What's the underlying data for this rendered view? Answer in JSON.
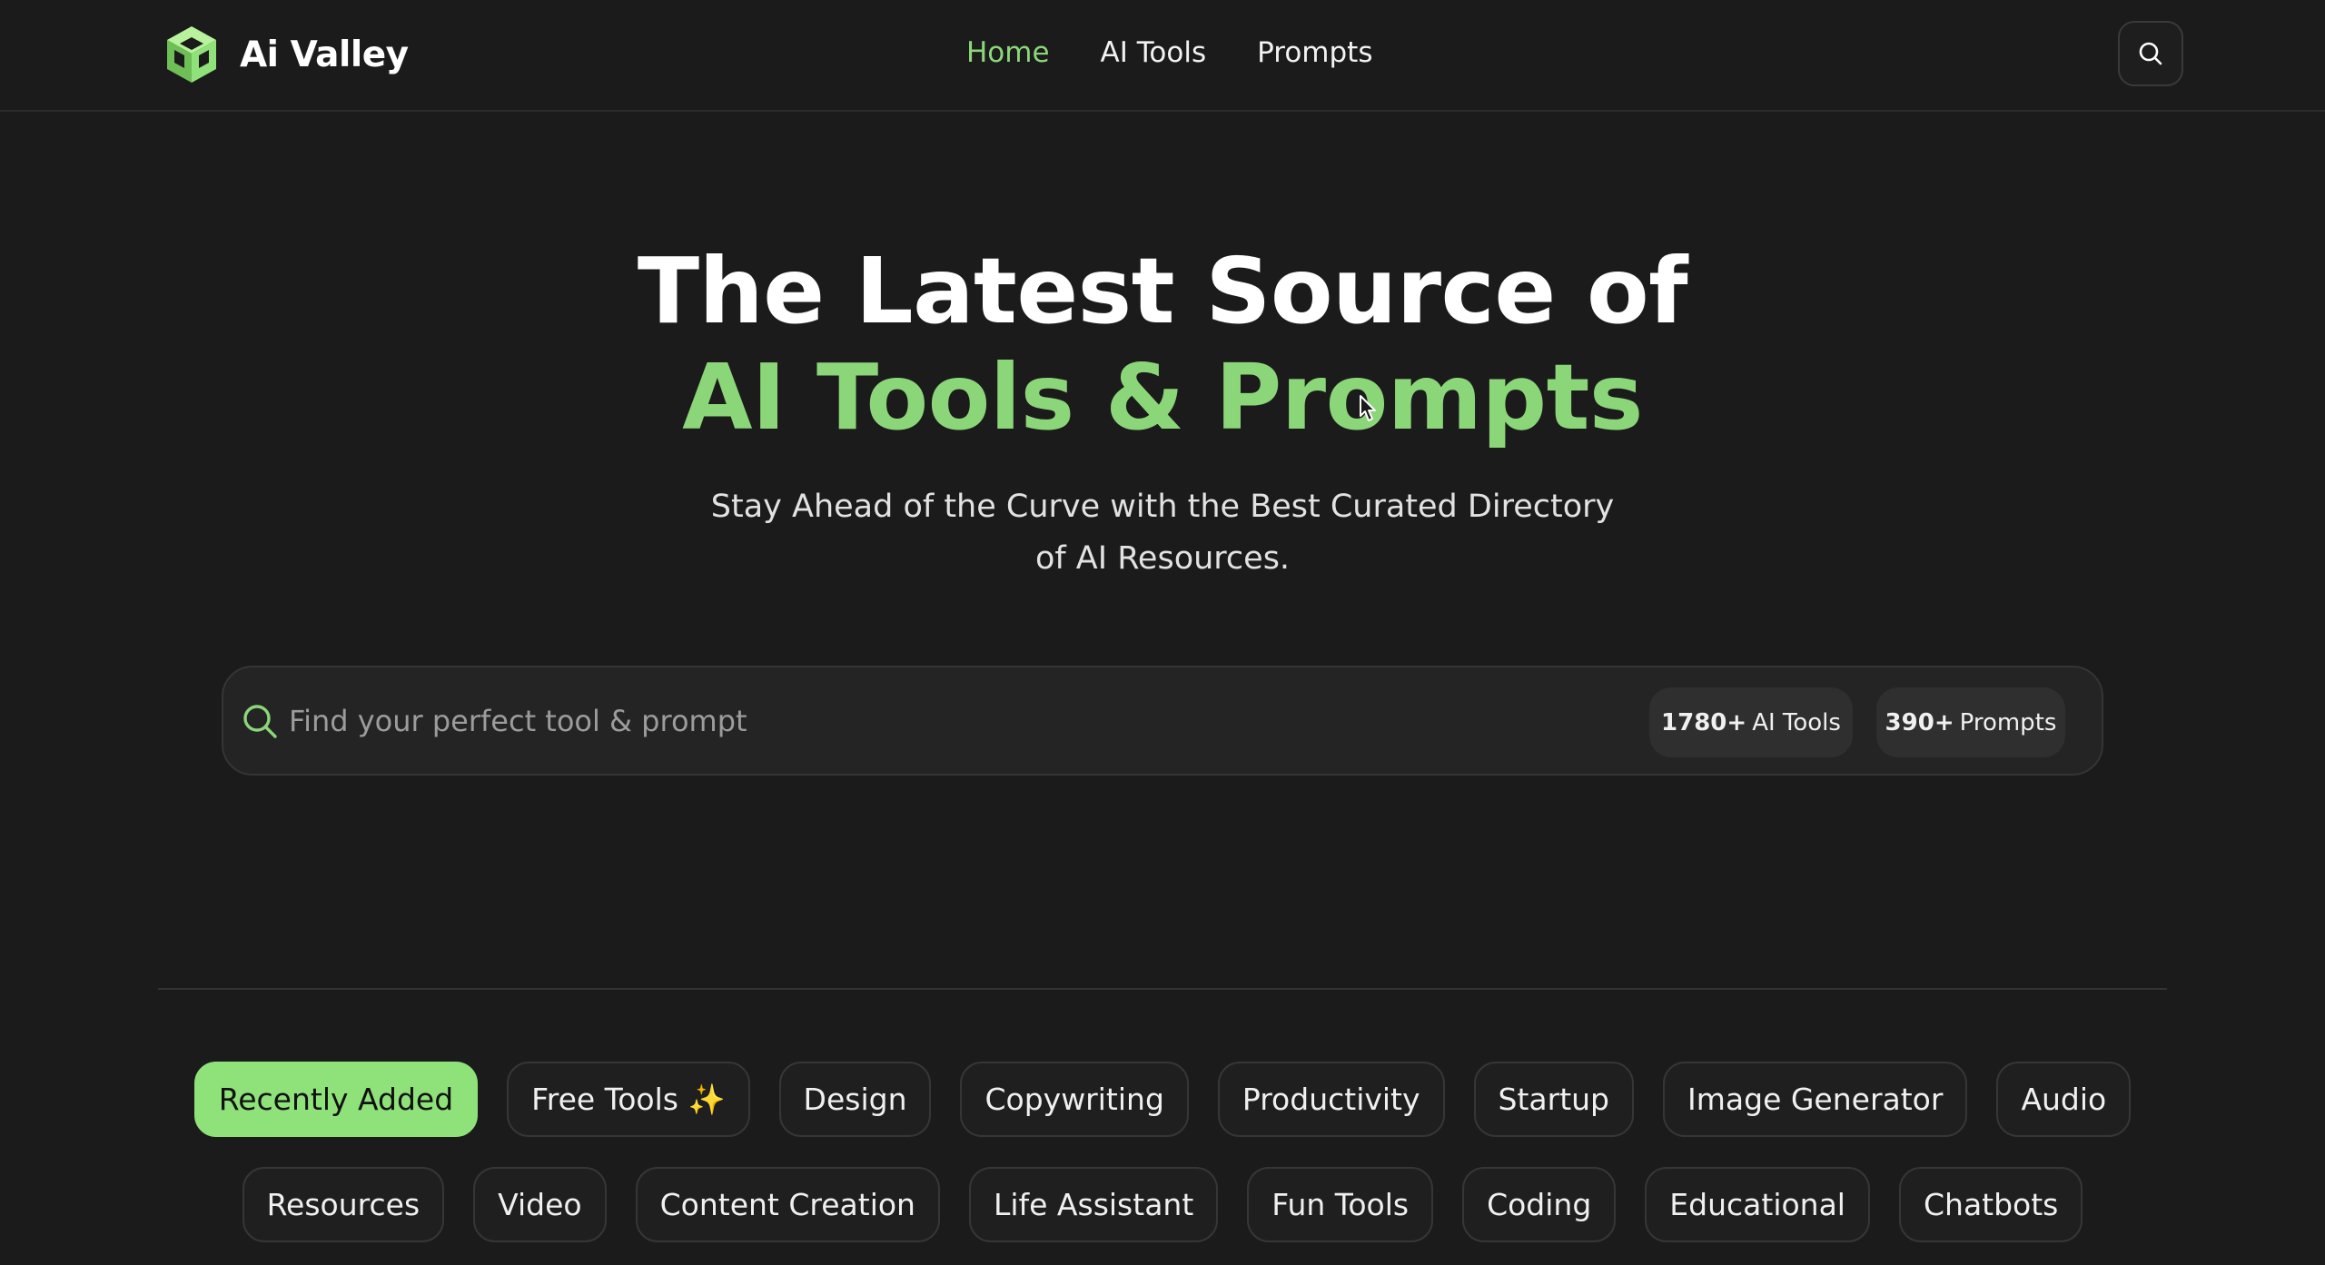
{
  "header": {
    "brand": "Ai Valley",
    "nav": [
      {
        "label": "Home",
        "active": true
      },
      {
        "label": "AI Tools",
        "active": false
      },
      {
        "label": "Prompts",
        "active": false
      }
    ],
    "search_icon": "search-icon"
  },
  "hero": {
    "line1": "The Latest Source of",
    "line2": "AI Tools & Prompts",
    "subtitle_line1": "Stay Ahead of the Curve with the Best Curated Directory",
    "subtitle_line2": "of AI Resources."
  },
  "search": {
    "placeholder": "Find your perfect tool & prompt",
    "value": "",
    "tools_count": "1780+",
    "tools_label": "AI Tools",
    "prompts_count": "390+",
    "prompts_label": "Prompts"
  },
  "categories": {
    "row1": [
      "Recently Added",
      "Free Tools ✨",
      "Design",
      "Copywriting",
      "Productivity",
      "Startup",
      "Image Generator",
      "Audio"
    ],
    "row2": [
      "Resources",
      "Video",
      "Content Creation",
      "Life Assistant",
      "Fun Tools",
      "Coding",
      "Educational",
      "Chatbots"
    ],
    "active": "Recently Added"
  },
  "colors": {
    "accent": "#8cd67a",
    "active_chip": "#8fe27a",
    "background": "#1b1b1b"
  }
}
